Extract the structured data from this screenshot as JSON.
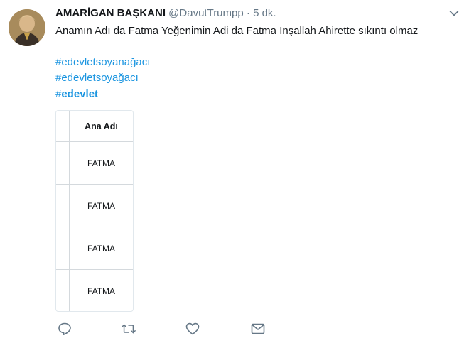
{
  "tweet": {
    "display_name": "AMARİGAN BAŞKANI",
    "handle": "@DavutTrumpp",
    "separator": "·",
    "time": "5 dk.",
    "text": "Anamın Adı da Fatma Yeğenimin Adi da Fatma Inşallah Ahirette sıkıntı olmaz",
    "hashtags": [
      "#edevletsoyanağacı",
      "#edevletsoyağacı"
    ],
    "hashtag_bold": {
      "hash": "#",
      "word": "edevlet"
    }
  },
  "table": {
    "header": "Ana Adı",
    "rows": [
      "FATMA",
      "FATMA",
      "FATMA",
      "FATMA"
    ]
  },
  "icons": {
    "menu": "chevron-down-icon",
    "reply": "reply-icon",
    "retweet": "retweet-icon",
    "like": "heart-icon",
    "message": "envelope-icon"
  },
  "colors": {
    "link": "#1b95e0",
    "muted": "#657786",
    "text": "#14171a"
  }
}
